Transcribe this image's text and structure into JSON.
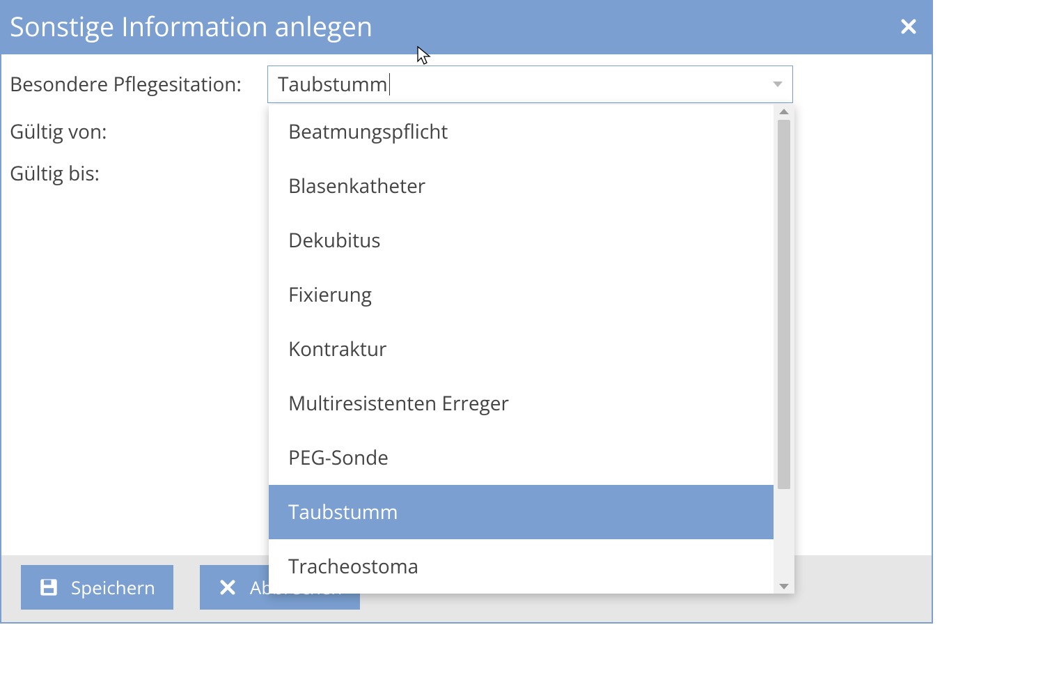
{
  "dialog": {
    "title": "Sonstige Information anlegen"
  },
  "form": {
    "situation_label": "Besondere Pflegesitation:",
    "situation_value": "Taubstumm",
    "valid_from_label": "Gültig von:",
    "valid_to_label": "Gültig bis:"
  },
  "combo": {
    "options": [
      {
        "label": "Beatmungspflicht",
        "selected": false
      },
      {
        "label": "Blasenkatheter",
        "selected": false
      },
      {
        "label": "Dekubitus",
        "selected": false
      },
      {
        "label": "Fixierung",
        "selected": false
      },
      {
        "label": "Kontraktur",
        "selected": false
      },
      {
        "label": "Multiresistenten Erreger",
        "selected": false
      },
      {
        "label": "PEG-Sonde",
        "selected": false
      },
      {
        "label": "Taubstumm",
        "selected": true
      },
      {
        "label": "Tracheostoma",
        "selected": false
      }
    ]
  },
  "buttons": {
    "save": "Speichern",
    "cancel": "Abbrechen"
  },
  "colors": {
    "primary": "#7a9fd0",
    "footer_bg": "#e6e6e6",
    "text": "#444"
  }
}
